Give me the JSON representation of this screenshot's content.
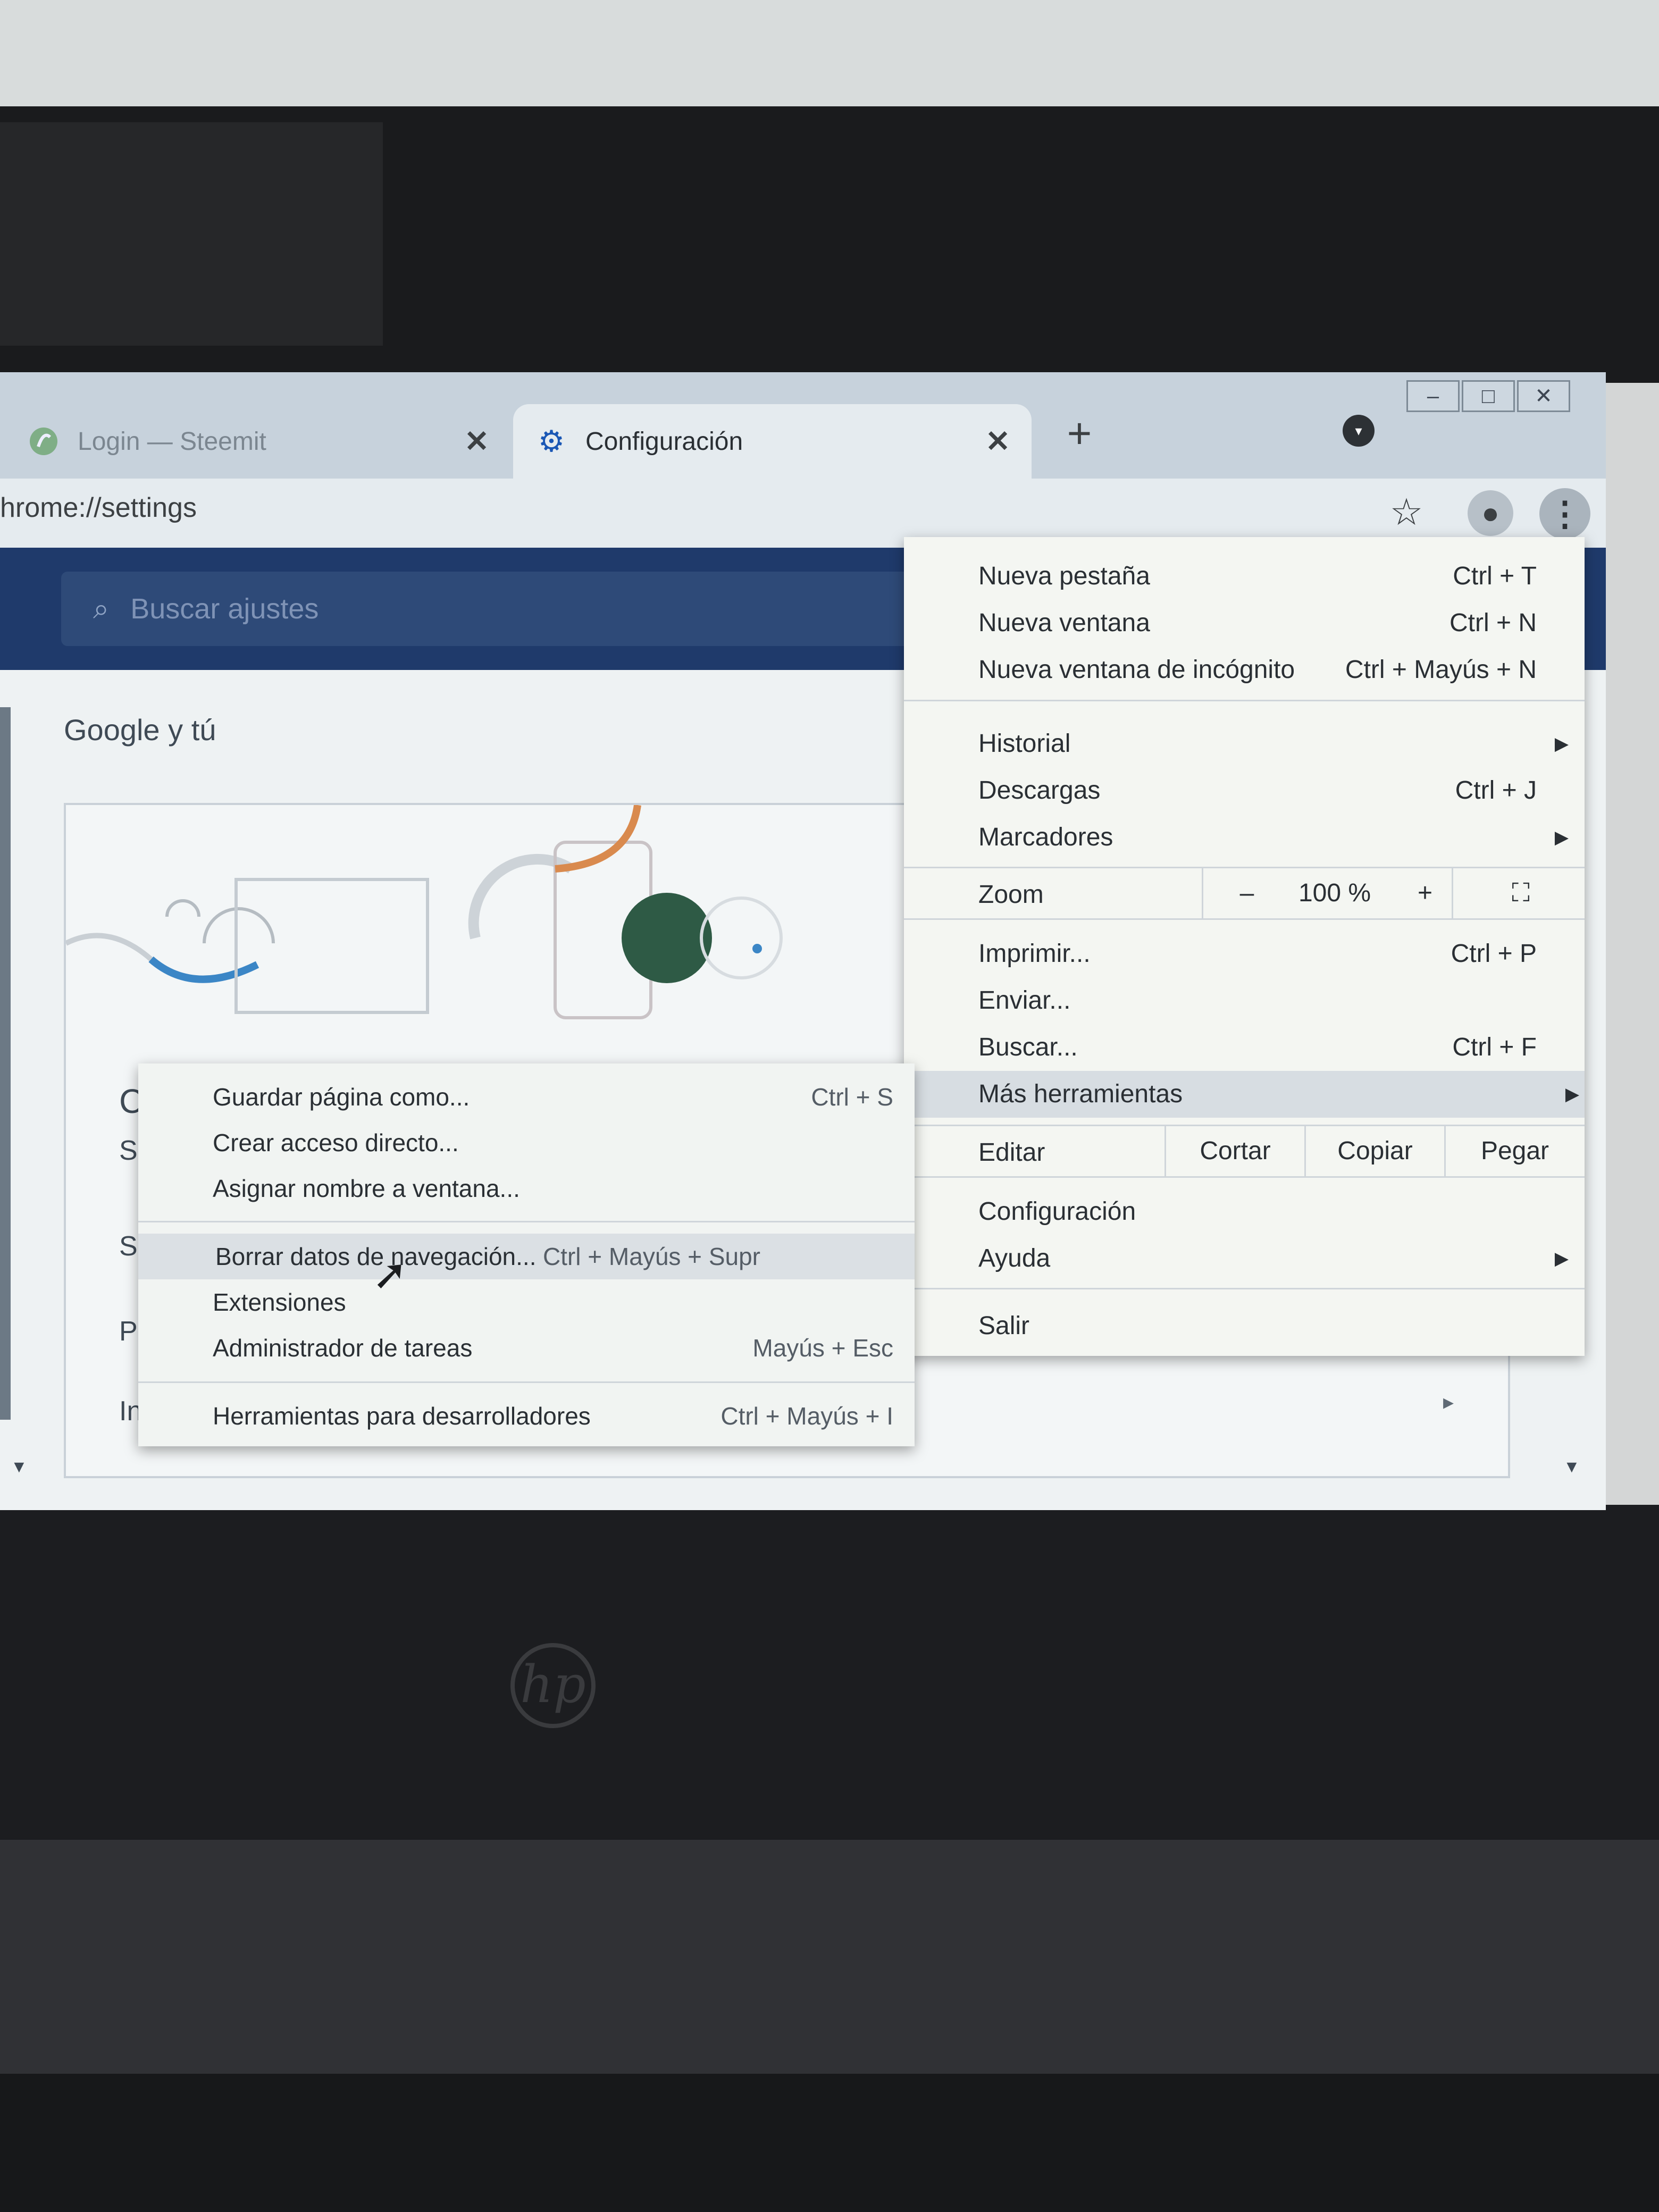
{
  "browser": {
    "tabs": [
      {
        "title": "Login — Steemit",
        "active": false,
        "icon": "steemit-icon"
      },
      {
        "title": "Configuración",
        "active": true,
        "icon": "gear-icon"
      }
    ],
    "new_tab": "+",
    "window_controls": {
      "minimize": "–",
      "maximize": "□",
      "close": "✕"
    },
    "address": "hrome://settings",
    "tab_close": "✕"
  },
  "settings": {
    "search_placeholder": "Buscar ajustes",
    "section_title": "Google y tú",
    "row_letters": [
      "C",
      "S",
      "S",
      "P",
      "In"
    ]
  },
  "main_menu": {
    "items": [
      {
        "label": "Nueva pestaña",
        "shortcut": "Ctrl + T"
      },
      {
        "label": "Nueva ventana",
        "shortcut": "Ctrl + N"
      },
      {
        "label": "Nueva ventana de incógnito",
        "shortcut": "Ctrl + Mayús + N"
      },
      {
        "label": "Historial",
        "shortcut": ""
      },
      {
        "label": "Descargas",
        "shortcut": "Ctrl + J"
      },
      {
        "label": "Marcadores",
        "shortcut": ""
      },
      {
        "label": "Imprimir...",
        "shortcut": "Ctrl + P"
      },
      {
        "label": "Enviar...",
        "shortcut": ""
      },
      {
        "label": "Buscar...",
        "shortcut": "Ctrl + F"
      },
      {
        "label": "Más herramientas",
        "shortcut": ""
      },
      {
        "label": "Configuración",
        "shortcut": ""
      },
      {
        "label": "Ayuda",
        "shortcut": ""
      },
      {
        "label": "Salir",
        "shortcut": ""
      }
    ],
    "zoom": {
      "label": "Zoom",
      "minus": "–",
      "value": "100 %",
      "plus": "+"
    },
    "edit": {
      "label": "Editar",
      "cut": "Cortar",
      "copy": "Copiar",
      "paste": "Pegar"
    }
  },
  "sub_menu": {
    "items": [
      {
        "label": "Guardar página como...",
        "shortcut": "Ctrl + S"
      },
      {
        "label": "Crear acceso directo...",
        "shortcut": ""
      },
      {
        "label": "Asignar nombre a ventana...",
        "shortcut": ""
      },
      {
        "label": "Borrar datos de navegación...",
        "shortcut": "Ctrl + Mayús + Supr"
      },
      {
        "label": "Extensiones",
        "shortcut": ""
      },
      {
        "label": "Administrador de tareas",
        "shortcut": "Mayús + Esc"
      },
      {
        "label": "Herramientas para desarrolladores",
        "shortcut": "Ctrl + Mayús + I"
      }
    ]
  },
  "colors": {
    "settings_header": "#1f3a6b",
    "menu_bg": "#f4f6f2",
    "highlight": "#d7dde2",
    "sync_circle": "#2e5a45"
  },
  "laptop": {
    "brand": "hp"
  }
}
